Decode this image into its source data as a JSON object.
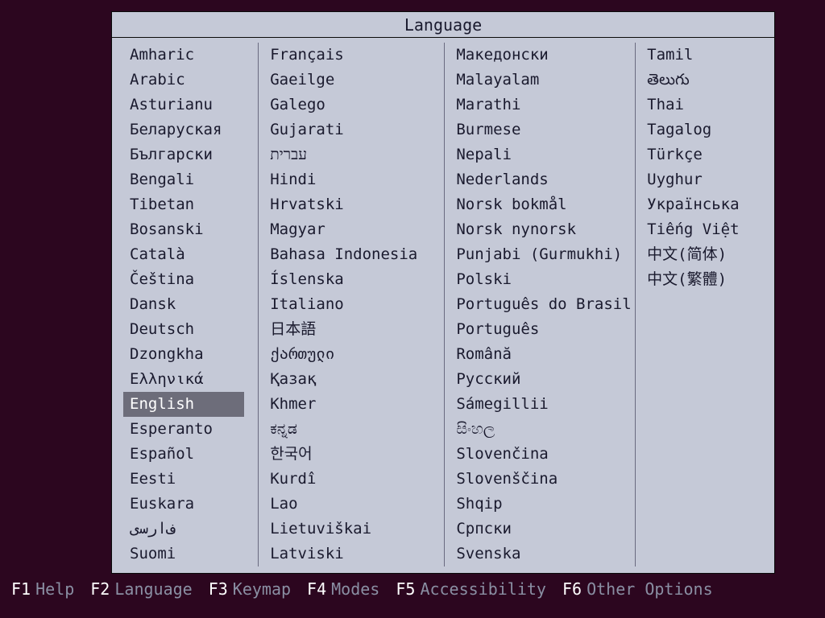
{
  "title": "Language",
  "selected": "English",
  "columns": [
    [
      "Amharic",
      "Arabic",
      "Asturianu",
      "Беларуская",
      "Български",
      "Bengali",
      "Tibetan",
      "Bosanski",
      "Català",
      "Čeština",
      "Dansk",
      "Deutsch",
      "Dzongkha",
      "Ελληνικά",
      "English",
      "Esperanto",
      "Español",
      "Eesti",
      "Euskara",
      "ﻑﺍﺭﺳی",
      "Suomi"
    ],
    [
      "Français",
      "Gaeilge",
      "Galego",
      "Gujarati",
      "עברית",
      "Hindi",
      "Hrvatski",
      "Magyar",
      "Bahasa Indonesia",
      "Íslenska",
      "Italiano",
      "日本語",
      "ქართული",
      "Қазақ",
      "Khmer",
      "ಕನ್ನಡ",
      "한국어",
      "Kurdî",
      "Lao",
      "Lietuviškai",
      "Latviski"
    ],
    [
      "Македонски",
      "Malayalam",
      "Marathi",
      "Burmese",
      "Nepali",
      "Nederlands",
      "Norsk bokmål",
      "Norsk nynorsk",
      "Punjabi (Gurmukhi)",
      "Polski",
      "Português do Brasil",
      "Português",
      "Română",
      "Русский",
      "Sámegillii",
      "සිංහල",
      "Slovenčina",
      "Slovenščina",
      "Shqip",
      "Српски",
      "Svenska"
    ],
    [
      "Tamil",
      "తెలుగు",
      "Thai",
      "Tagalog",
      "Türkçe",
      "Uyghur",
      "Українська",
      "Tiếng Việt",
      "中文(简体)",
      "中文(繁體)"
    ]
  ],
  "fkeys": [
    {
      "key": "F1",
      "label": "Help"
    },
    {
      "key": "F2",
      "label": "Language"
    },
    {
      "key": "F3",
      "label": "Keymap"
    },
    {
      "key": "F4",
      "label": "Modes"
    },
    {
      "key": "F5",
      "label": "Accessibility"
    },
    {
      "key": "F6",
      "label": "Other Options"
    }
  ]
}
